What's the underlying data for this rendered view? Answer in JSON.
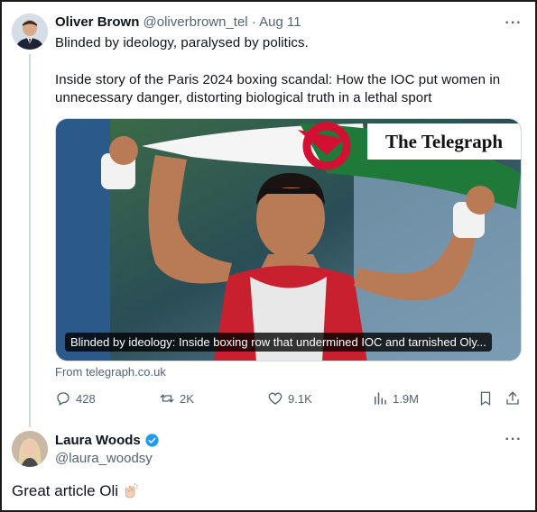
{
  "tweet1": {
    "author_name": "Oliver Brown",
    "author_handle": "@oliverbrown_tel",
    "separator": "·",
    "date": "Aug 11",
    "text_line1": "Blinded by ideology, paralysed by politics.",
    "text_line2": "Inside story of the Paris 2024 boxing scandal: How the IOC put women in",
    "text_line3": "unnecessary danger, distorting biological truth in a lethal sport",
    "media": {
      "brand": "The Telegraph",
      "caption": "Blinded by ideology: Inside boxing row that undermined IOC and tarnished Oly..."
    },
    "source": "From telegraph.co.uk",
    "stats": {
      "replies": "428",
      "reposts": "2K",
      "likes": "9.1K",
      "views": "1.9M"
    },
    "more_icon": "more-horizontal-icon"
  },
  "tweet2": {
    "author_name": "Laura Woods",
    "author_handle": "@laura_woodsy",
    "verified": true,
    "text": "Great article Oli",
    "emoji": "clapping-hands"
  },
  "colors": {
    "text_primary": "#0f1419",
    "text_secondary": "#536471",
    "verified_blue": "#1d9bf0",
    "thread_line": "#cfd9de"
  }
}
